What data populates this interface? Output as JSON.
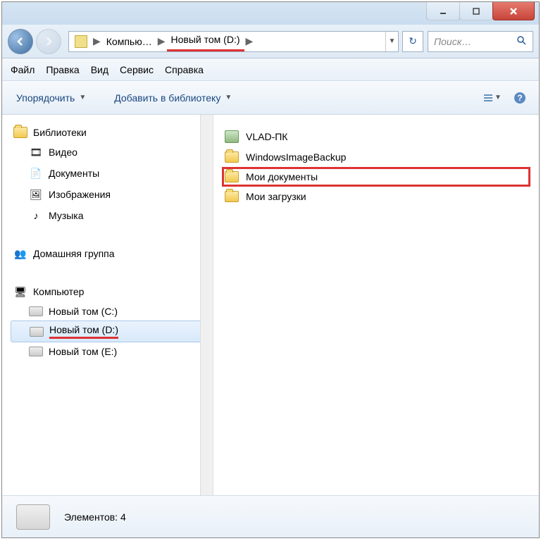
{
  "titlebar": {
    "minimize_aria": "Minimize",
    "maximize_aria": "Maximize",
    "close_aria": "Close"
  },
  "nav": {
    "back_aria": "Back",
    "forward_aria": "Forward",
    "refresh_aria": "Refresh"
  },
  "breadcrumb": {
    "item1": "Компью…",
    "item2": "Новый том (D:)"
  },
  "search": {
    "placeholder": "Поиск…"
  },
  "menu": {
    "file": "Файл",
    "edit": "Правка",
    "view": "Вид",
    "service": "Сервис",
    "help": "Справка"
  },
  "toolbar": {
    "organize": "Упорядочить",
    "add_library": "Добавить в библиотеку"
  },
  "sidebar": {
    "libraries": "Библиотеки",
    "video": "Видео",
    "documents": "Документы",
    "pictures": "Изображения",
    "music": "Музыка",
    "homegroup": "Домашняя группа",
    "computer": "Компьютер",
    "drive_c": "Новый том (C:)",
    "drive_d": "Новый том (D:)",
    "drive_e": "Новый том (E:)"
  },
  "main": {
    "items": {
      "vlad_pc": "VLAD-ПК",
      "win_backup": "WindowsImageBackup",
      "my_docs": "Мои документы",
      "my_downloads": "Мои загрузки"
    }
  },
  "status": {
    "elements_label": "Элементов: 4"
  }
}
